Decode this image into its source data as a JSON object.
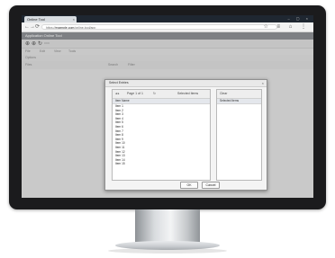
{
  "browser": {
    "tab_title": "Online Tool",
    "tab_close": "×",
    "window_controls": "– ▢ ×",
    "nav_back": "←",
    "nav_forward": "→",
    "nav_reload": "⟳",
    "url_scheme": "https://",
    "url_domain": "example.com",
    "url_path": "/online-tool/app",
    "nav_icons": "☆ ≡ ⌂ ⋮"
  },
  "app": {
    "header": "Application Online Tool",
    "tools": [
      "⊕",
      "⊕",
      "↻",
      "⋯"
    ],
    "menu": [
      "File",
      "Edit",
      "View",
      "Tools"
    ],
    "line_items": [
      "Options"
    ],
    "filter_items": [
      "Files",
      "Search",
      "Filter"
    ]
  },
  "dialog": {
    "title": "Select Entries",
    "close": "×",
    "left_toolbar": {
      "nav": "◂ ▸",
      "page": "Page 1 of 1",
      "refresh": "↻",
      "right": "Selected Items"
    },
    "left_header": "Item Name",
    "items": [
      "Item 1",
      "Item 2",
      "Item 3",
      "Item 4",
      "Item 5",
      "Item 6",
      "Item 7",
      "Item 8",
      "Item 9",
      "Item 10",
      "Item 11",
      "Item 12",
      "Item 13",
      "Item 14",
      "Item 15"
    ],
    "right_toolbar": "Clear",
    "right_header": "Selected Items",
    "ok_label": "OK",
    "cancel_label": "Cancel"
  }
}
